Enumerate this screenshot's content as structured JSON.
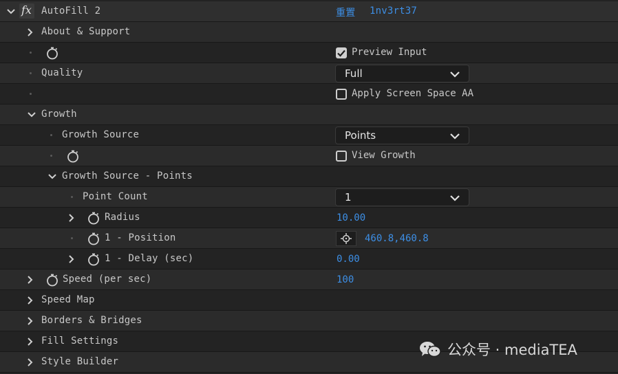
{
  "effect": {
    "name": "AutoFill 2",
    "fx_badge": "fx",
    "reset_label": "重置",
    "plugin_link": "1nv3rt37"
  },
  "rows": {
    "about": "About & Support",
    "preview_input": "Preview Input",
    "quality_label": "Quality",
    "quality_value": "Full",
    "apply_aa": "Apply Screen Space AA",
    "growth": "Growth",
    "growth_source_label": "Growth Source",
    "growth_source_value": "Points",
    "view_growth": "View Growth",
    "growth_points_group": "Growth Source - Points",
    "point_count_label": "Point Count",
    "point_count_value": "1",
    "radius_label": "Radius",
    "radius_value": "10.00",
    "position_label": "1 - Position",
    "position_value": "460.8,460.8",
    "delay_label": "1 - Delay (sec)",
    "delay_value": "0.00",
    "speed_label": "Speed (per sec)",
    "speed_value": "100",
    "speed_map": "Speed Map",
    "borders": "Borders & Bridges",
    "fill_settings": "Fill Settings",
    "style_builder": "Style Builder"
  },
  "checkboxes": {
    "preview_input": true,
    "apply_aa": false,
    "view_growth": false
  },
  "watermark": {
    "text": "公众号 · mediaTEA"
  },
  "colors": {
    "background": "#232323",
    "row_alt": "#2b2b2b",
    "accent_value": "#3d8fe6",
    "text": "#c8c8c8"
  },
  "icons": [
    "fx-icon",
    "chevron-right-icon",
    "chevron-down-icon",
    "stopwatch-icon",
    "crosshair-icon",
    "checkbox-icon",
    "wechat-icon"
  ]
}
